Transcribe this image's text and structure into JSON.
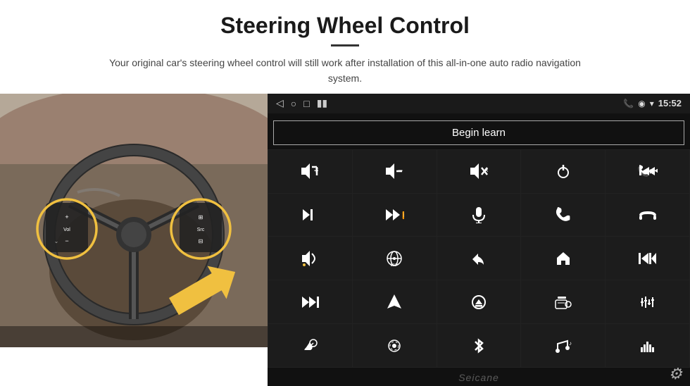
{
  "header": {
    "title": "Steering Wheel Control",
    "subtitle": "Your original car's steering wheel control will still work after installation of this all-in-one auto radio navigation system."
  },
  "statusBar": {
    "time": "15:52",
    "icons": [
      "phone",
      "location",
      "wifi",
      "battery"
    ]
  },
  "beginLearnButton": "Begin learn",
  "controls": [
    {
      "icon": "🔊+",
      "name": "vol-up"
    },
    {
      "icon": "🔊−",
      "name": "vol-down"
    },
    {
      "icon": "🔇",
      "name": "mute"
    },
    {
      "icon": "⏻",
      "name": "power"
    },
    {
      "icon": "📞⏮",
      "name": "call-prev"
    },
    {
      "icon": "⏭",
      "name": "next-track"
    },
    {
      "icon": "⏪⏩",
      "name": "ff-rw"
    },
    {
      "icon": "🎙",
      "name": "mic"
    },
    {
      "icon": "📞",
      "name": "call"
    },
    {
      "icon": "📵",
      "name": "end-call"
    },
    {
      "icon": "🔈",
      "name": "speaker"
    },
    {
      "icon": "🔄",
      "name": "360"
    },
    {
      "icon": "↩",
      "name": "back"
    },
    {
      "icon": "🏠",
      "name": "home"
    },
    {
      "icon": "⏮⏮",
      "name": "prev-chapter"
    },
    {
      "icon": "⏭",
      "name": "fast-fwd"
    },
    {
      "icon": "▶",
      "name": "nav"
    },
    {
      "icon": "⏏",
      "name": "eject"
    },
    {
      "icon": "📻",
      "name": "radio"
    },
    {
      "icon": "🎛",
      "name": "eq"
    },
    {
      "icon": "🎤",
      "name": "mic2"
    },
    {
      "icon": "⊙",
      "name": "settings2"
    },
    {
      "icon": "✱",
      "name": "bluetooth"
    },
    {
      "icon": "🎵",
      "name": "music"
    },
    {
      "icon": "📊",
      "name": "spectrum"
    }
  ],
  "watermark": "Seicane",
  "nav": {
    "back": "◁",
    "home": "○",
    "recents": "□",
    "signal": "▮▮"
  }
}
